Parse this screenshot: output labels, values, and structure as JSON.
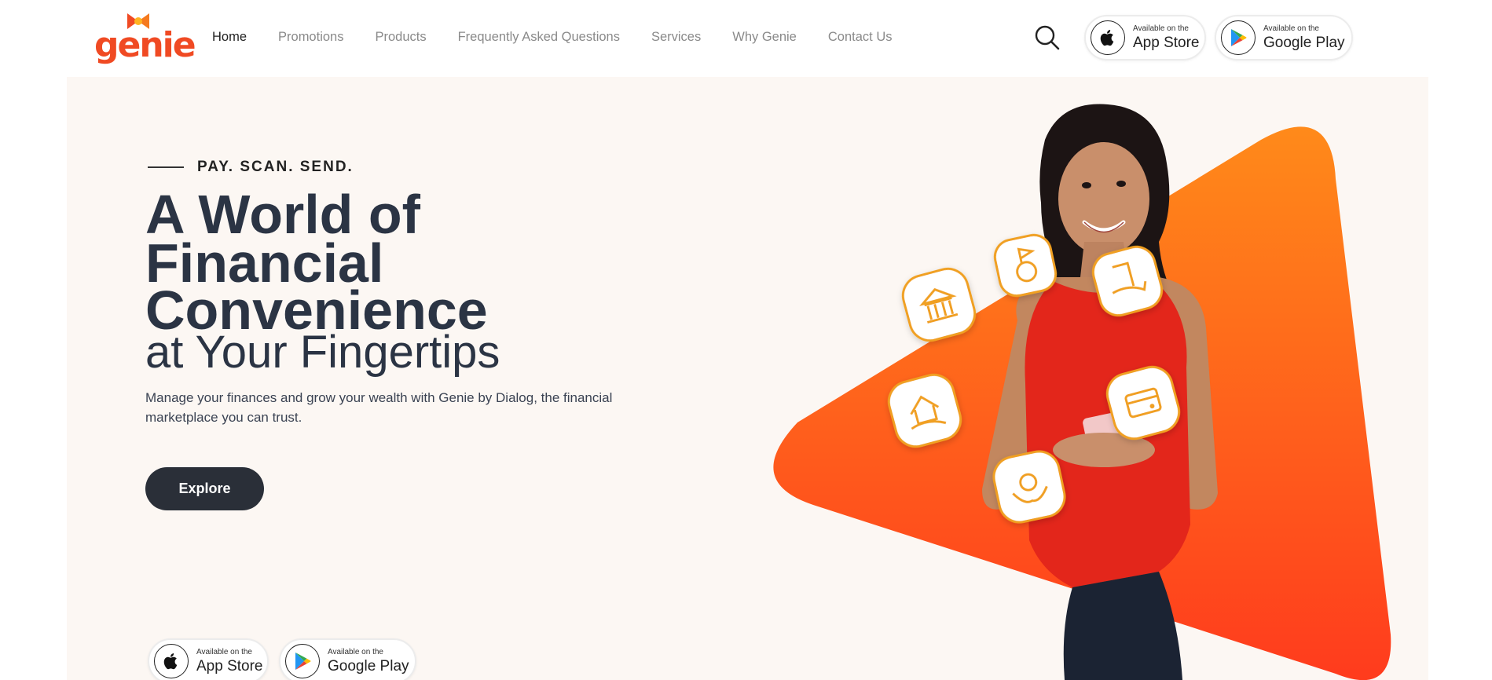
{
  "brand": {
    "logo_text": "genie"
  },
  "nav": {
    "items": [
      {
        "label": "Home",
        "active": true
      },
      {
        "label": "Promotions",
        "active": false
      },
      {
        "label": "Products",
        "active": false
      },
      {
        "label": "Frequently Asked Questions",
        "active": false
      },
      {
        "label": "Services",
        "active": false
      },
      {
        "label": "Why Genie",
        "active": false
      },
      {
        "label": "Contact Us",
        "active": false
      }
    ]
  },
  "header_badges": {
    "app_store": {
      "small": "Available on the",
      "big": "App Store",
      "icon": "apple-icon"
    },
    "google_play": {
      "small": "Available on the",
      "big": "Google Play",
      "icon": "google-play-icon"
    }
  },
  "hero": {
    "eyebrow": "PAY. SCAN. SEND.",
    "headline_1": "A World of",
    "headline_2": "Financial",
    "headline_3": "Convenience",
    "headline_4": "at Your Fingertips",
    "description": "Manage your finances and grow your wealth with Genie by Dialog, the financial marketplace you can trust.",
    "cta_label": "Explore",
    "service_icons": [
      "bank-icon",
      "loan-medal-icon",
      "insurance-hand-icon",
      "home-loan-icon",
      "card-icon",
      "savings-hands-icon"
    ]
  },
  "hero_badges": {
    "app_store": {
      "small": "Available on the",
      "big": "App Store",
      "icon": "apple-icon"
    },
    "google_play": {
      "small": "Available on the",
      "big": "Google Play",
      "icon": "google-play-icon"
    }
  },
  "colors": {
    "brand_orange": "#f04a23",
    "triangle_top": "#ff8a1a",
    "triangle_bottom": "#ff3b1d",
    "hero_bg": "#fcf7f3",
    "heading": "#2b3444",
    "button_dark": "#2a2f38",
    "icon_gold": "#f0a020"
  }
}
